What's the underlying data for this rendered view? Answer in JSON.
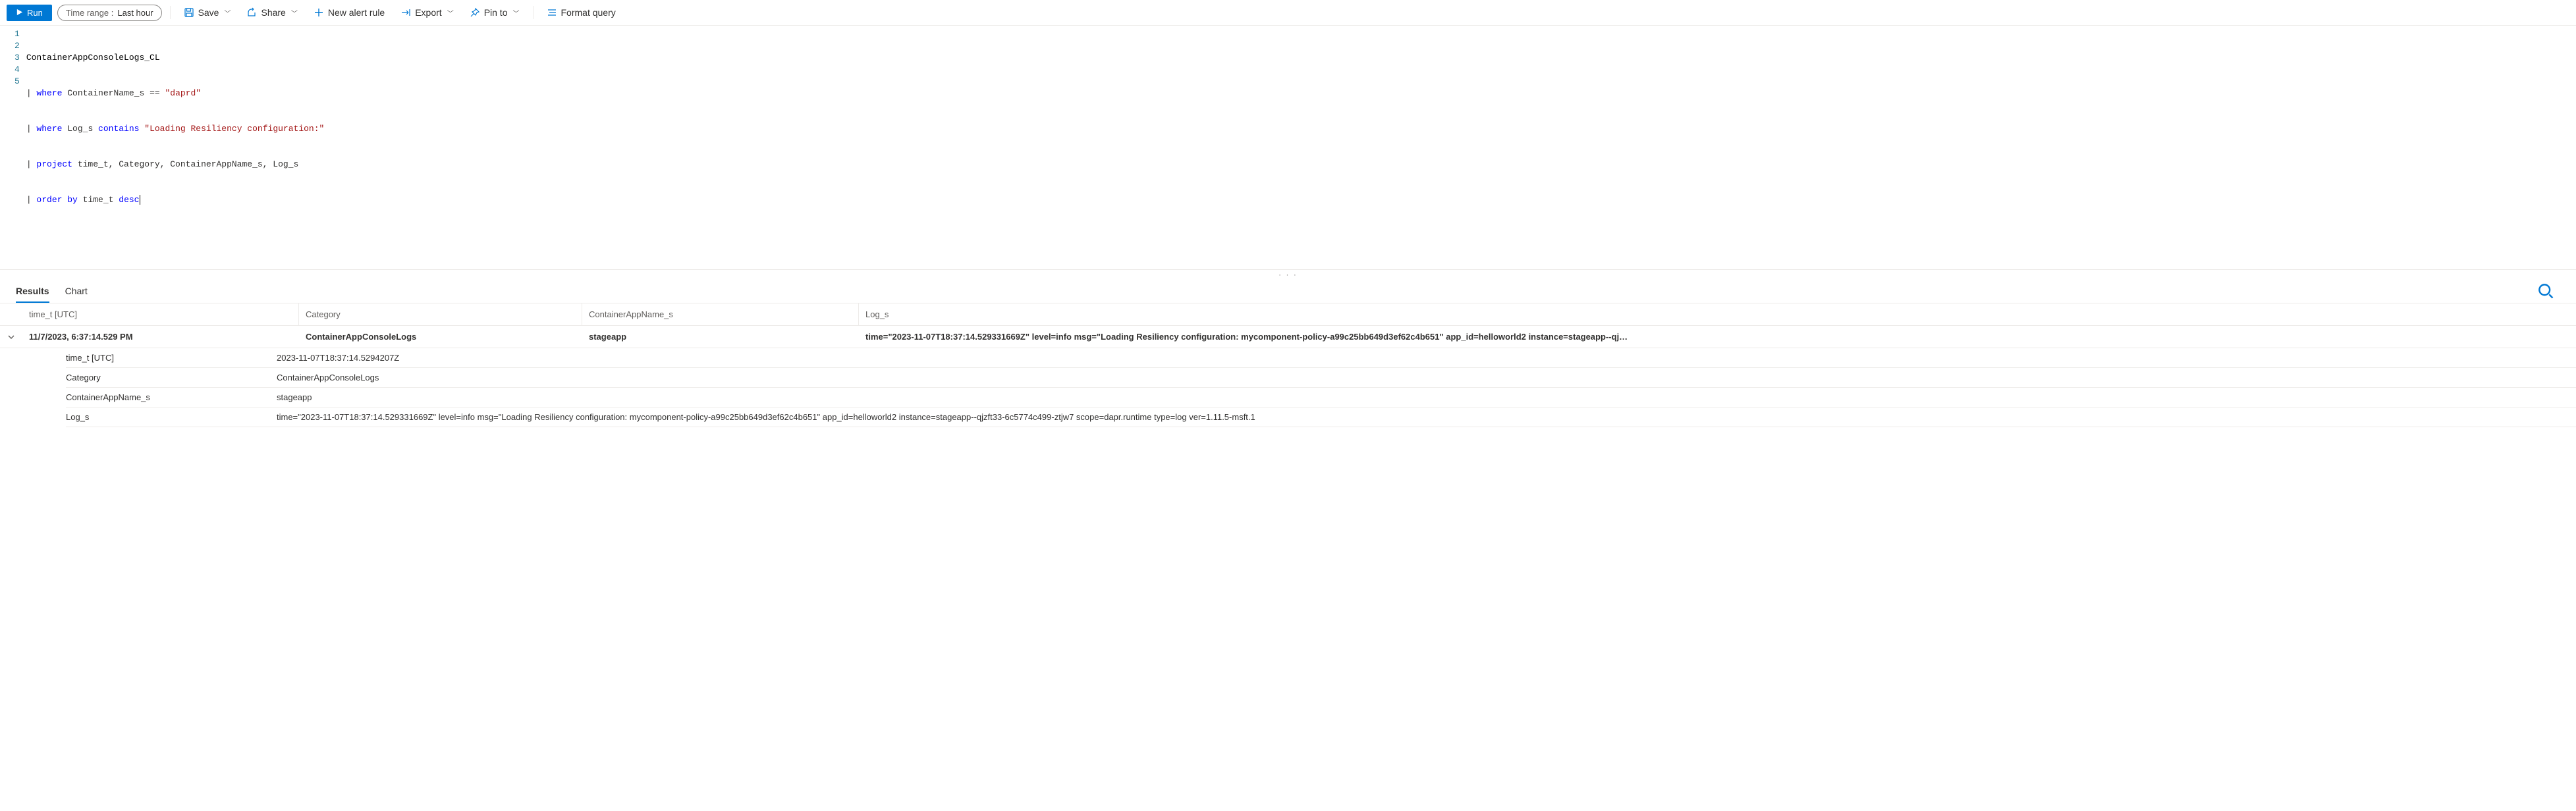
{
  "toolbar": {
    "run": "Run",
    "timerange_label": "Time range :",
    "timerange_value": "Last hour",
    "save": "Save",
    "share": "Share",
    "new_alert": "New alert rule",
    "export": "Export",
    "pin": "Pin to",
    "format": "Format query"
  },
  "editor": {
    "lines": [
      "ContainerAppConsoleLogs_CL",
      "| where ContainerName_s == \"daprd\"",
      "| where Log_s contains \"Loading Resiliency configuration:\"",
      "| project time_t, Category, ContainerAppName_s, Log_s",
      "| order by time_t desc"
    ]
  },
  "tabs": {
    "results": "Results",
    "chart": "Chart"
  },
  "table": {
    "headers": [
      "time_t [UTC]",
      "Category",
      "ContainerAppName_s",
      "Log_s"
    ],
    "row": {
      "time_display": "11/7/2023, 6:37:14.529 PM",
      "category": "ContainerAppConsoleLogs",
      "app": "stageapp",
      "log_pre": "time=\"2023-11-07T18:37:14.529331669Z\" level=info msg=\"",
      "log_underlined": "Loading Resiliency configuration: mycomponent-policy-a99c25bb649d3ef62c4b651\"",
      "log_post": " app_id=helloworld2 instance=stageapp--qj…"
    },
    "details": [
      {
        "key": "time_t [UTC]",
        "val": "2023-11-07T18:37:14.5294207Z"
      },
      {
        "key": "Category",
        "val": "ContainerAppConsoleLogs"
      },
      {
        "key": "ContainerAppName_s",
        "val": "stageapp"
      },
      {
        "key": "Log_s",
        "val": "time=\"2023-11-07T18:37:14.529331669Z\" level=info msg=\"Loading Resiliency configuration: mycomponent-policy-a99c25bb649d3ef62c4b651\" app_id=helloworld2 instance=stageapp--qjzft33-6c5774c499-ztjw7 scope=dapr.runtime type=log ver=1.11.5-msft.1"
      }
    ]
  }
}
